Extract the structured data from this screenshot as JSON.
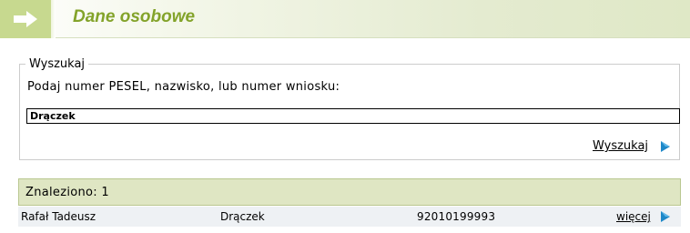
{
  "header": {
    "title": "Dane osobowe",
    "icon": "arrow-right-icon"
  },
  "search": {
    "legend": "Wyszukaj",
    "prompt": "Podaj numer PESEL, nazwisko, lub numer wniosku:",
    "value": "Drączek",
    "submit_label": "Wyszukaj",
    "submit_icon": "play-arrow-icon"
  },
  "results": {
    "count_text": "Znaleziono: 1",
    "rows": [
      {
        "name": "Rafał Tadeusz",
        "surname": "Drączek",
        "pesel": "92010199993",
        "more_label": "więcej"
      }
    ]
  },
  "colors": {
    "title": "#83a32a",
    "header_icon_bg": "#c7d98f",
    "result_bar": "#dfe6c3",
    "link_arrow": "#1e88c8"
  }
}
